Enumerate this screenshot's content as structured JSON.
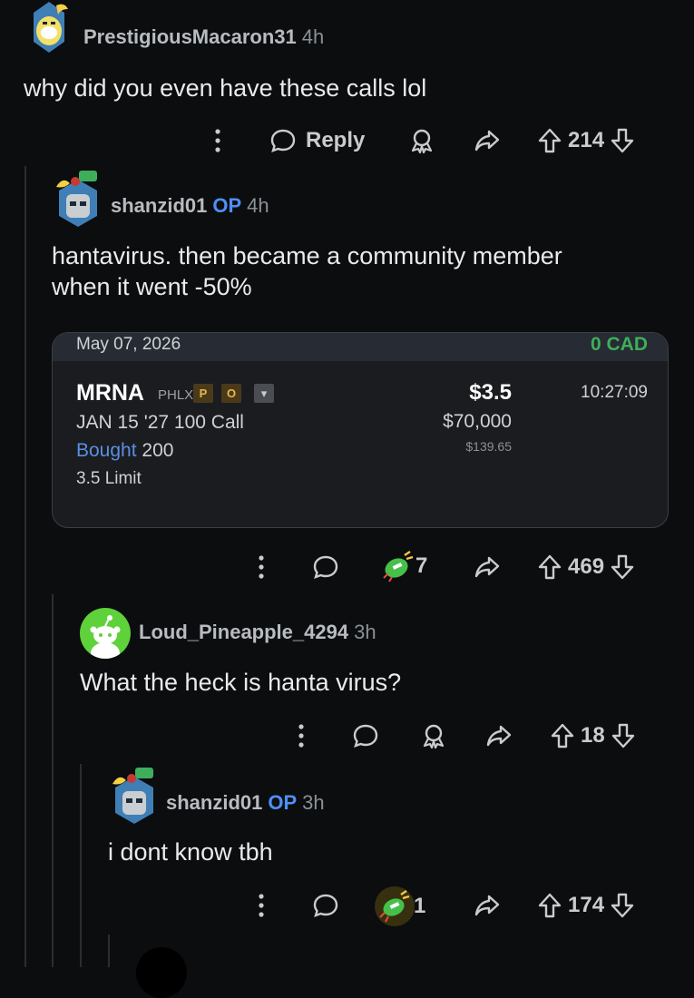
{
  "comments": [
    {
      "user": "PrestigiousMacaron31",
      "op": "",
      "time": "4h",
      "text": "why did you even have these calls lol",
      "reply_label": "Reply",
      "votes": "214",
      "award_count": ""
    },
    {
      "user": "shanzid01",
      "op": "OP",
      "time": "4h",
      "text_lines": [
        "hantavirus. then became a community member",
        "when it went -50%"
      ],
      "votes": "469",
      "award_count": "7"
    },
    {
      "user": "Loud_Pineapple_4294",
      "op": "",
      "time": "3h",
      "text": "What the heck is hanta virus?",
      "votes": "18",
      "award_count": ""
    },
    {
      "user": "shanzid01",
      "op": "OP",
      "time": "3h",
      "text": "i dont know tbh",
      "votes": "174",
      "award_count": "1"
    }
  ],
  "trade": {
    "date": "May 07, 2026",
    "currency": "0 CAD",
    "ticker": "MRNA",
    "exchange": "PHLX",
    "chips": [
      "P",
      "O",
      "▾"
    ],
    "contract": "JAN 15 '27 100 Call",
    "side": "Bought",
    "qty": "200",
    "order_type": "3.5 Limit",
    "price": "$3.5",
    "total": "$70,000",
    "fee": "$139.65",
    "time": "10:27:09"
  },
  "colors": {
    "background": "#0b0d0f",
    "op": "#4f8ff7",
    "cad": "#3fae5a",
    "bought": "#5b8fe0"
  },
  "icons": [
    "more-vertical-icon",
    "comment-bubble-icon",
    "award-icon",
    "share-icon",
    "upvote-icon",
    "downvote-icon"
  ]
}
